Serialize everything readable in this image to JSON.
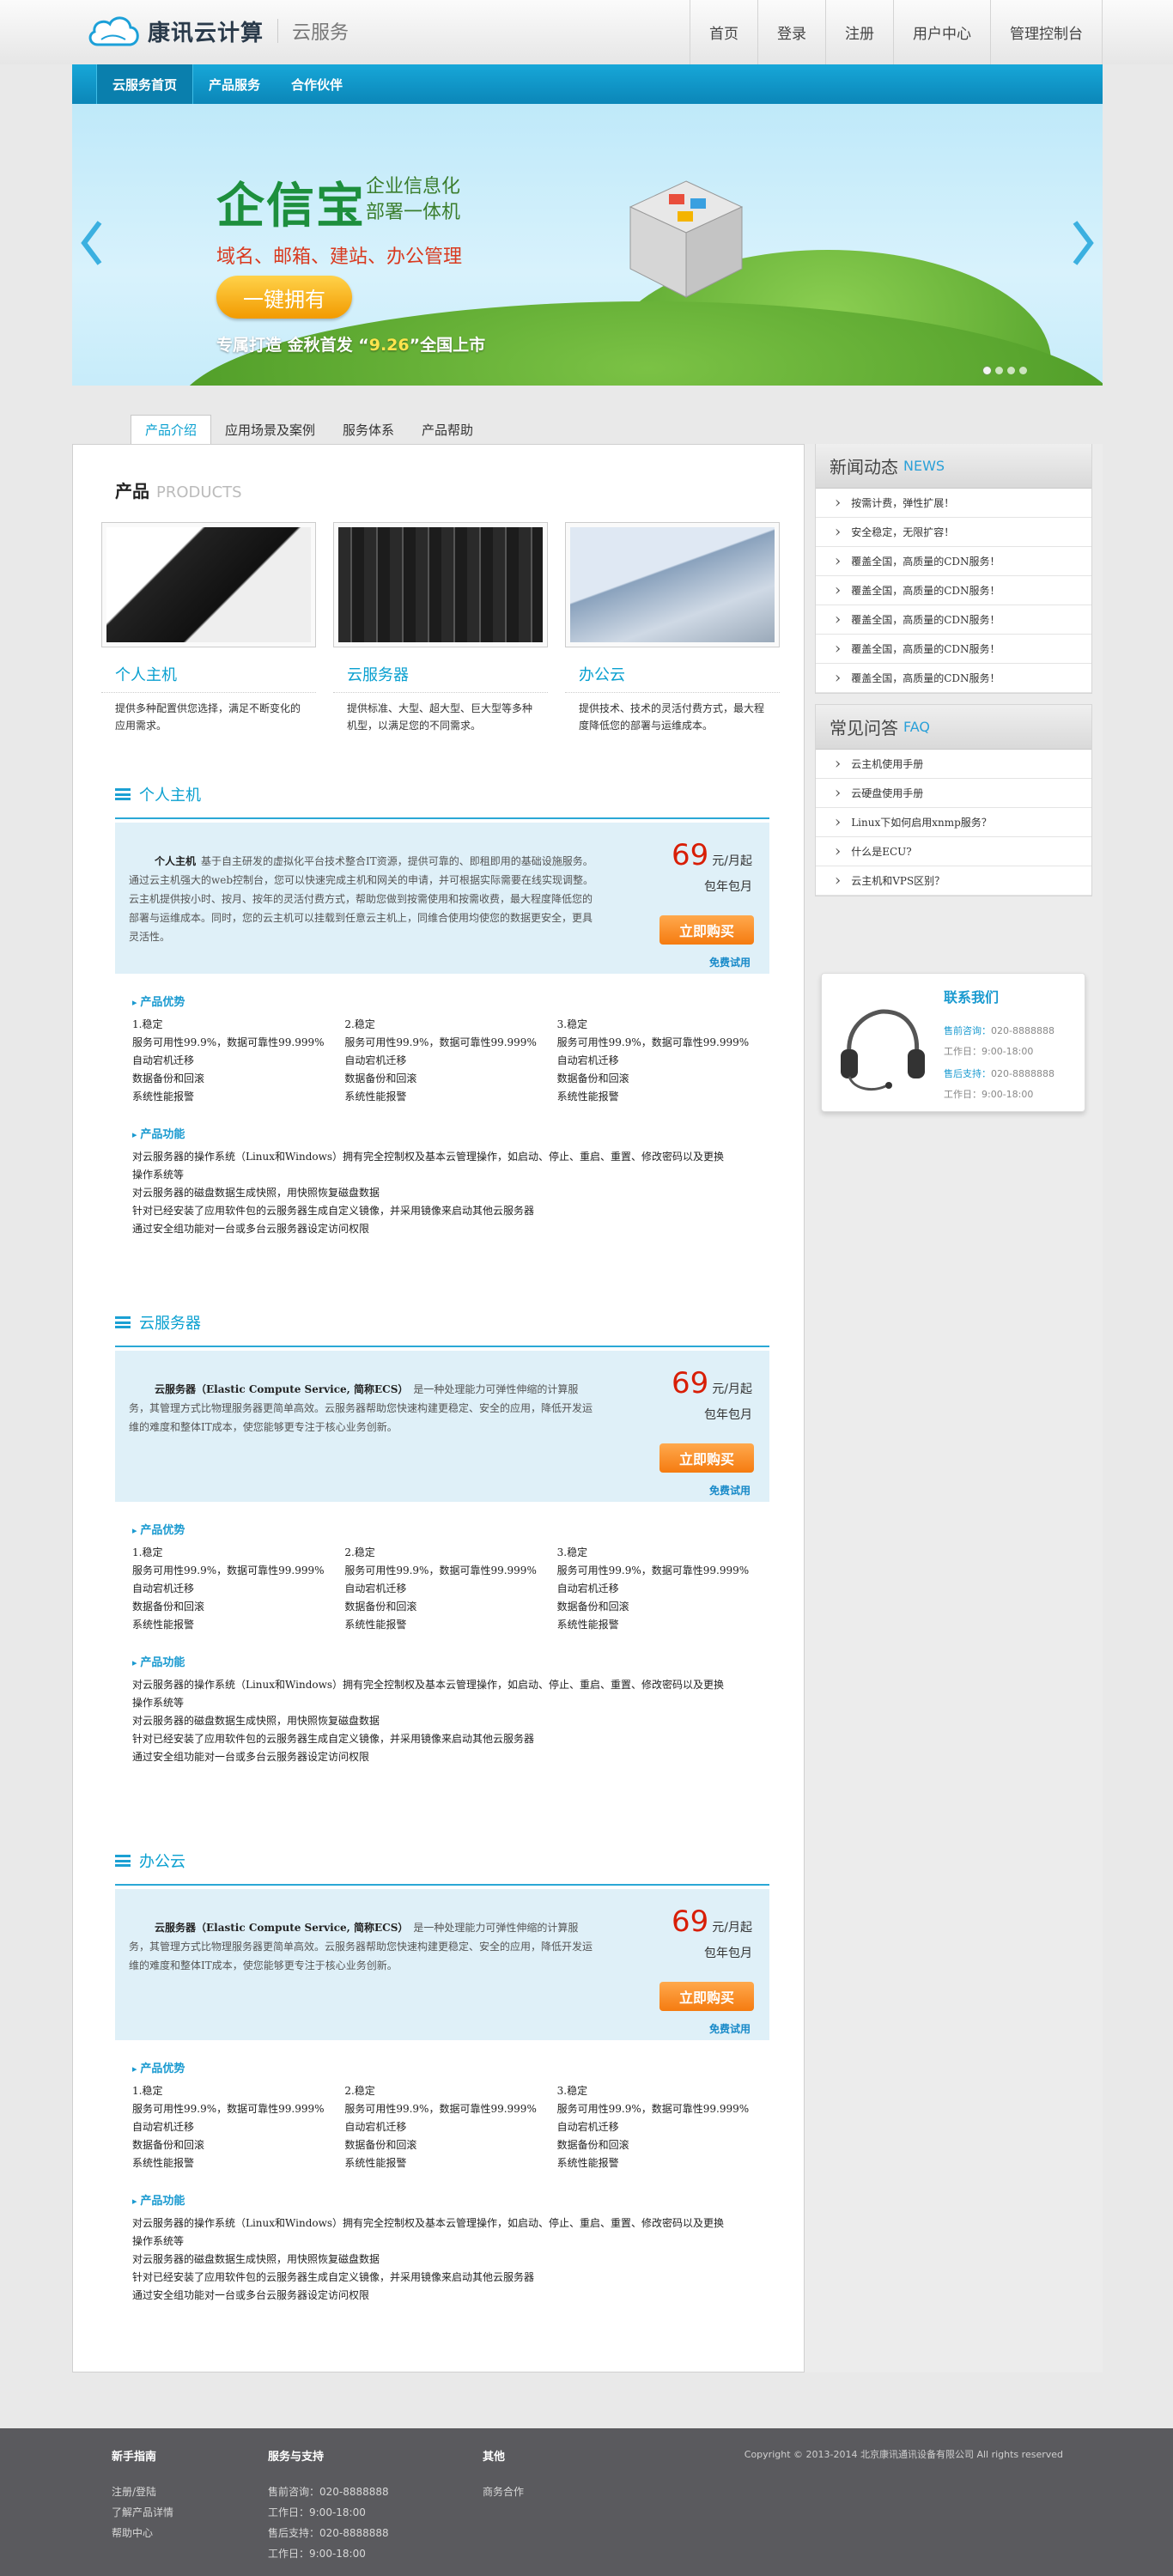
{
  "header": {
    "logo_text": "康讯云计算",
    "logo_sub": "云服务",
    "nav": [
      "首页",
      "登录",
      "注册",
      "用户中心",
      "管理控制台"
    ]
  },
  "mainnav": {
    "items": [
      "云服务首页",
      "产品服务",
      "合作伙伴"
    ]
  },
  "banner": {
    "title": "企信宝",
    "subtitle1": "企业信息化",
    "subtitle2": "部署一体机",
    "line": "域名、邮箱、建站、办公管理",
    "button": "一键拥有",
    "foot1": "专属打造  金秋首发  “",
    "date": "9.26",
    "foot2": "”全国上市"
  },
  "tabs": [
    "产品介绍",
    "应用场景及案例",
    "服务体系",
    "产品帮助"
  ],
  "products": {
    "heading": "产品",
    "heading_en": "PRODUCTS",
    "items": [
      {
        "title": "个人主机",
        "desc": "提供多种配置供您选择，满足不断变化的应用需求。"
      },
      {
        "title": "云服务器",
        "desc": "提供标准、大型、超大型、巨大型等多种机型，以满足您的不同需求。"
      },
      {
        "title": "办公云",
        "desc": "提供技术、技术的灵活付费方式，最大程度降低您的部署与运维成本。"
      }
    ]
  },
  "blocks": [
    {
      "title": "个人主机",
      "lead": "个人主机",
      "desc": "基于自主研发的虚拟化平台技术整合IT资源，提供可靠的、即租即用的基础设施服务。通过云主机强大的web控制台，您可以快速完成主机和网关的申请，并可根据实际需要在线实现调整。云主机提供按小时、按月、按年的灵活付费方式，帮助您做到按需使用和按需收费，最大程度降低您的部署与运维成本。同时，您的云主机可以挂载到任意云主机上，同维合使用均使您的数据更安全，更具灵活性。",
      "price": "69",
      "unit": "元/月起",
      "pack": "包年包月",
      "buy": "立即购买",
      "trial": "免费试用"
    },
    {
      "title": "云服务器",
      "lead": "云服务器（Elastic Compute Service, 简称ECS）",
      "desc": "是一种处理能力可弹性伸缩的计算服务，其管理方式比物理服务器更简单高效。云服务器帮助您快速构建更稳定、安全的应用，降低开发运维的难度和整体IT成本，使您能够更专注于核心业务创新。",
      "price": "69",
      "unit": "元/月起",
      "pack": "包年包月",
      "buy": "立即购买",
      "trial": "免费试用"
    },
    {
      "title": "办公云",
      "lead": "云服务器（Elastic Compute Service, 简称ECS）",
      "desc": "是一种处理能力可弹性伸缩的计算服务，其管理方式比物理服务器更简单高效。云服务器帮助您快速构建更稳定、安全的应用，降低开发运维的难度和整体IT成本，使您能够更专注于核心业务创新。",
      "price": "69",
      "unit": "元/月起",
      "pack": "包年包月",
      "buy": "立即购买",
      "trial": "免费试用"
    }
  ],
  "adv": {
    "heading": "产品优势",
    "col": [
      "1.稳定",
      "服务可用性99.9%，数据可靠性99.999%",
      "自动宕机迁移",
      "数据备份和回滚",
      "系统性能报警"
    ],
    "col2": [
      "2.稳定",
      "服务可用性99.9%，数据可靠性99.999%",
      "自动宕机迁移",
      "数据备份和回滚",
      "系统性能报警"
    ],
    "col3": [
      "3.稳定",
      "服务可用性99.9%，数据可靠性99.999%",
      "自动宕机迁移",
      "数据备份和回滚",
      "系统性能报警"
    ]
  },
  "func": {
    "heading": "产品功能",
    "lines": [
      "对云服务器的操作系统（Linux和Windows）拥有完全控制权及基本云管理操作，如启动、停止、重启、重置、修改密码以及更换操作系统等",
      "对云服务器的磁盘数据生成快照，用快照恢复磁盘数据",
      "针对已经安装了应用软件包的云服务器生成自定义镜像，并采用镜像来启动其他云服务器",
      "通过安全组功能对一台或多台云服务器设定访问权限"
    ]
  },
  "news": {
    "title": "新闻动态",
    "title_en": "NEWS",
    "items": [
      "按需计费，弹性扩展！",
      "安全稳定，无限扩容！",
      "覆盖全国，高质量的CDN服务！",
      "覆盖全国，高质量的CDN服务！",
      "覆盖全国，高质量的CDN服务！",
      "覆盖全国，高质量的CDN服务！",
      "覆盖全国，高质量的CDN服务！"
    ]
  },
  "faq": {
    "title": "常见问答",
    "title_en": "FAQ",
    "items": [
      "云主机使用手册",
      "云硬盘使用手册",
      "Linux下如何启用xnmp服务？",
      "什么是ECU?",
      "云主机和VPS区别？"
    ]
  },
  "contact": {
    "title": "联系我们",
    "pre_label": "售前咨询：",
    "pre_phone": "020-8888888",
    "hours1": "工作日：9:00-18:00",
    "post_label": "售后支持：",
    "post_phone": "020-8888888",
    "hours2": "工作日：9:00-18:00"
  },
  "footer": {
    "c1": {
      "title": "新手指南",
      "items": [
        "注册/登陆",
        "了解产品详情",
        "帮助中心"
      ]
    },
    "c2": {
      "title": "服务与支持",
      "items": [
        "售前咨询：020-8888888",
        "工作日：9:00-18:00",
        "售后支持：020-8888888",
        "工作日：9:00-18:00"
      ]
    },
    "c3": {
      "title": "其他",
      "items": [
        "商务合作"
      ]
    },
    "copyright": "Copyright © 2013-2014  北京康讯通讯设备有限公司   All rights reserved"
  },
  "colors": {
    "accent": "#0aa0d0",
    "nav": "#0b86b8",
    "price": "#d81e06",
    "button": "#f57b10",
    "footer": "#5a5a5e"
  }
}
